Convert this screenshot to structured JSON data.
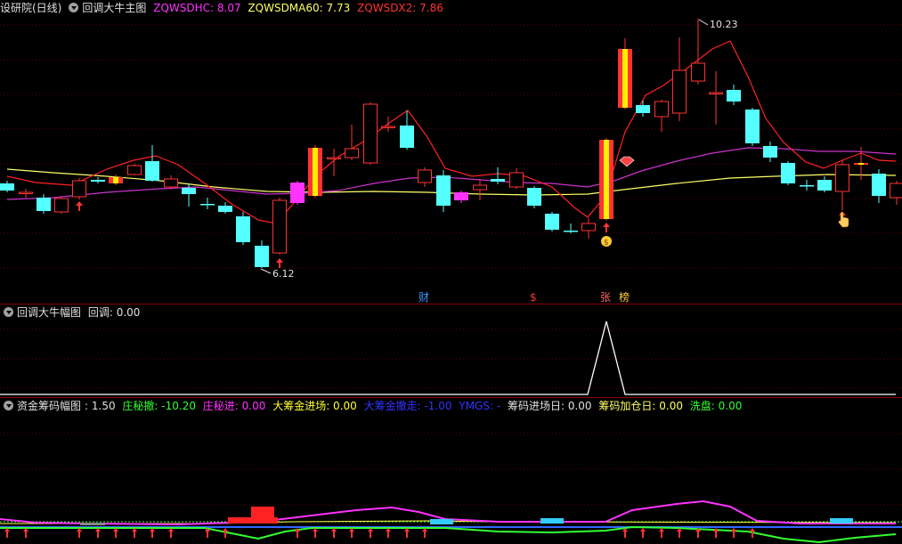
{
  "main": {
    "title": "设研院(日线)",
    "indicator_name": "回调大牛主图",
    "legend": [
      {
        "label": "ZQWSDHC: 8.07",
        "color": "#ff33ff"
      },
      {
        "label": "ZQWSDMA60: 7.73",
        "color": "#ffff66"
      },
      {
        "label": "ZQWSDX2: 7.86",
        "color": "#ff3333"
      }
    ],
    "high_label": "10.23",
    "low_label": "6.12",
    "markers": [
      {
        "text": "财",
        "color": "#3399ff"
      },
      {
        "text": "$",
        "color": "#ff3333"
      },
      {
        "text": "张",
        "color": "#ff6666"
      },
      {
        "text": "榜",
        "color": "#ffcc33"
      }
    ]
  },
  "sub1": {
    "indicator_name": "回调大牛幅图",
    "value_label": "回调: 0.00"
  },
  "sub2": {
    "indicator_name": "资金筹码幅图",
    "items": [
      {
        "label": ": 1.50",
        "color": "#e0e0e0"
      },
      {
        "label": "庄秘撤: -10.20",
        "color": "#33ff33"
      },
      {
        "label": "庄秘进: 0.00",
        "color": "#ff33ff"
      },
      {
        "label": "大筹金进场: 0.00",
        "color": "#ffff33"
      },
      {
        "label": "大筹金撤走: -1.00",
        "color": "#3333ff"
      },
      {
        "label": "YMGS: -",
        "color": "#3333ff"
      },
      {
        "label": "筹码进场日: 0.00",
        "color": "#e0e0e0"
      },
      {
        "label": "筹码加仓日: 0.00",
        "color": "#ffff66"
      },
      {
        "label": "洗盘: 0.00",
        "color": "#33ff33"
      }
    ]
  },
  "colors": {
    "up": "#ff3333",
    "down": "#54ffff",
    "ma_pink": "#cc33cc",
    "ma_yellow": "#ffff66",
    "ma_red": "#ff2222"
  }
}
